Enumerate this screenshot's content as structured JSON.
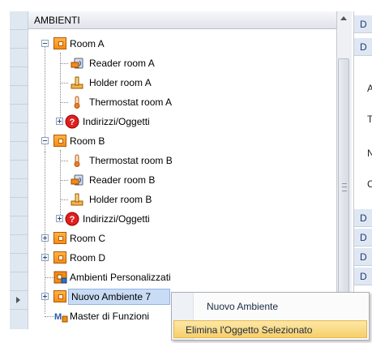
{
  "tree": {
    "header": "AMBIENTI",
    "rows": [
      {
        "label": "Room A"
      },
      {
        "label": "Reader room A"
      },
      {
        "label": "Holder room A"
      },
      {
        "label": "Thermostat room A"
      },
      {
        "label": "Indirizzi/Oggetti"
      },
      {
        "label": "Room B"
      },
      {
        "label": "Thermostat room B"
      },
      {
        "label": "Reader room B"
      },
      {
        "label": "Holder room B"
      },
      {
        "label": "Indirizzi/Oggetti"
      },
      {
        "label": "Room C"
      },
      {
        "label": "Room D"
      },
      {
        "label": "Ambienti Personalizzati"
      },
      {
        "label": "Nuovo Ambiente 7"
      },
      {
        "label": "Master di Funzioni"
      }
    ]
  },
  "right_panel": {
    "cells": [
      "D",
      "D",
      "D",
      "D",
      "D",
      "D"
    ],
    "labels": [
      "A",
      "T",
      "N",
      "C"
    ]
  },
  "context_menu": {
    "items": [
      "Nuovo Ambiente",
      "Elimina l'Oggetto Selezionato"
    ]
  },
  "colors": {
    "selection": "#c9dcf5",
    "menu_highlight": "#f7cf6a",
    "room_icon": "#f58c13",
    "help_icon": "#e02020"
  }
}
